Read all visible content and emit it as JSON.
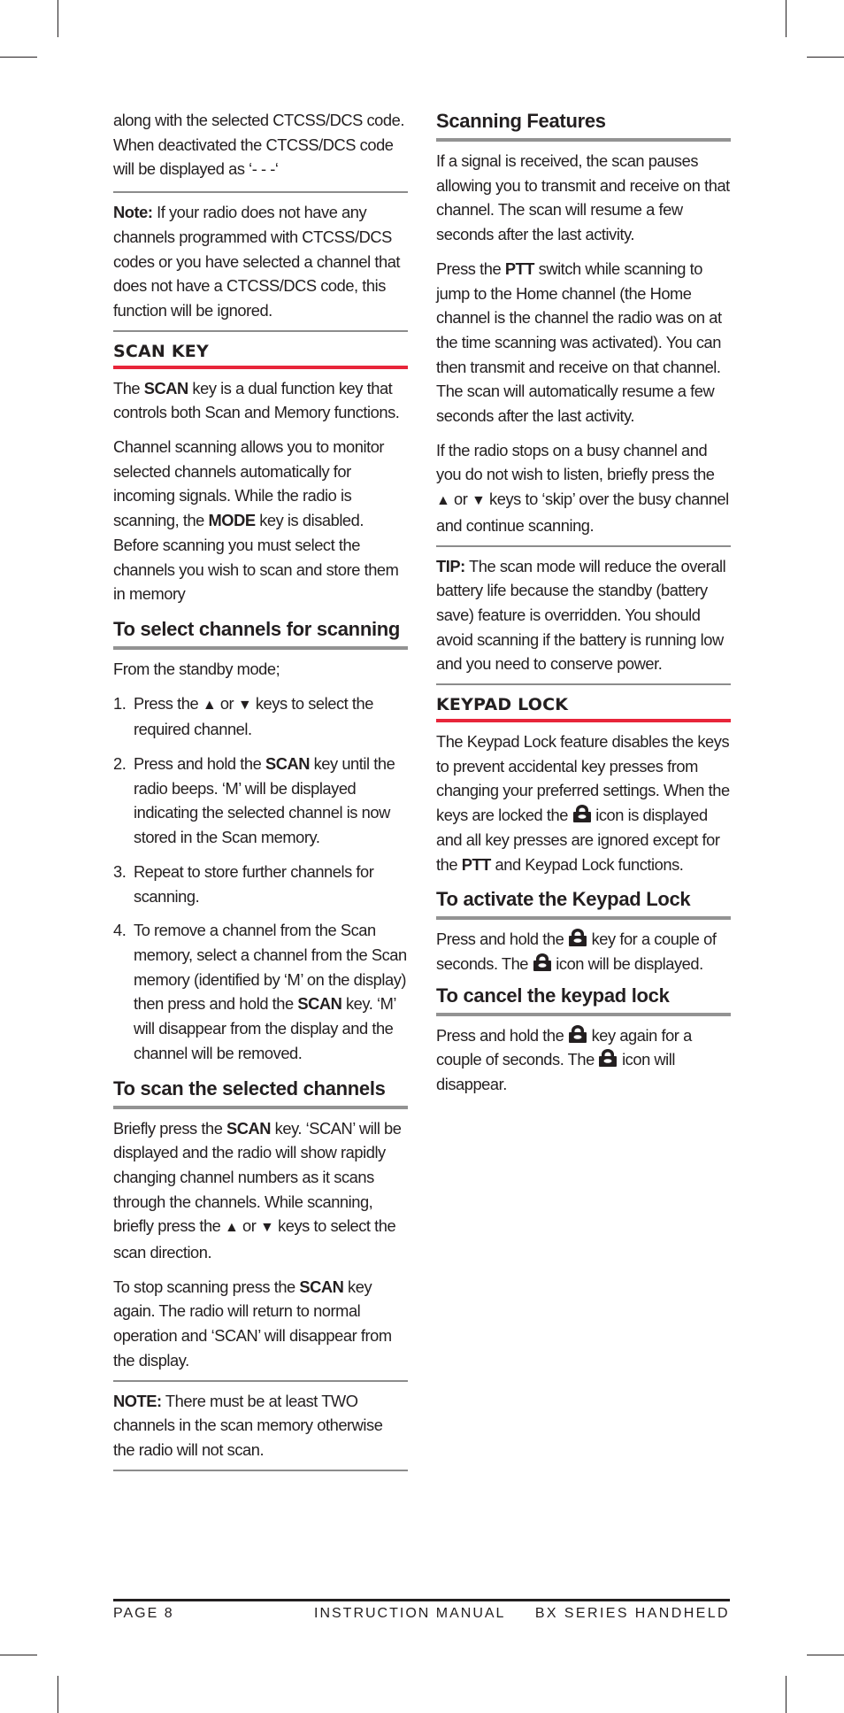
{
  "left_column": {
    "intro_text": "along with the selected CTCSS/DCS code. When deactivated the CTCSS/DCS code will be displayed as ‘- - -‘",
    "note1": {
      "label": "Note:",
      "text": " If your radio does not have any channels programmed with CTCSS/DCS codes or you have selected a channel that does not have a CTCSS/DCS code, this function will be ignored."
    },
    "scan_key": {
      "heading": "SCAN KEY",
      "p1": {
        "a": "The ",
        "b": "SCAN",
        "c": " key is a dual function key that controls both Scan and Memory functions."
      },
      "p2": {
        "a": "Channel scanning allows you to monitor selected channels automatically for incoming signals. While the radio is scanning, the ",
        "b": "MODE",
        "c": " key is disabled. Before scanning you must select the channels you wish to scan and store them in memory"
      }
    },
    "select_channels": {
      "heading": "To select channels for scanning",
      "intro": "From the standby mode;",
      "steps": [
        {
          "num": "1.",
          "a": "Press the ",
          "up": "▲",
          "or": " or ",
          "down": "▼",
          "b": " keys to select the required channel."
        },
        {
          "num": "2.",
          "a": "Press and hold the ",
          "bold": "SCAN",
          "b": " key until the radio beeps. ‘M’ will be displayed indicating the selected channel is now stored in the Scan memory."
        },
        {
          "num": "3.",
          "a": "Repeat to store further channels for scanning."
        },
        {
          "num": "4.",
          "a": "To remove a channel from the Scan memory, select a channel from the Scan memory (identified by ‘M’ on the display) then press and hold the ",
          "bold": "SCAN",
          "b": " key. ‘M’ will disappear from the display and the channel will be removed."
        }
      ]
    },
    "scan_selected": {
      "heading": "To scan the selected channels",
      "p1": {
        "a": "Briefly press the ",
        "b": "SCAN",
        "c": " key. ‘SCAN’ will be displayed and the radio will show rapidly changing channel numbers as it scans through the channels. While scanning, briefly press the ",
        "up": "▲",
        "or": " or ",
        "down": "▼",
        "d": " keys to select the scan direction."
      },
      "p2": {
        "a": "To stop scanning press the ",
        "b": "SCAN",
        "c": " key again. The radio will return to normal operation and ‘SCAN’ will disappear from the display."
      },
      "note": {
        "label": "NOTE:",
        "text": " There must be at least TWO channels in the scan memory otherwise the radio will not scan."
      }
    }
  },
  "right_column": {
    "scanning_features": {
      "heading": "Scanning Features",
      "p1": "If a signal is received, the scan pauses allowing you to transmit and receive on that channel. The scan will resume a few seconds after the last activity.",
      "p2": {
        "a": "Press the ",
        "b": "PTT",
        "c": " switch while scanning to jump to the Home channel (the Home channel is the channel the radio was on at the time scanning was activated). You can then transmit and receive on that channel. The scan will automatically resume a few seconds after the last activity."
      },
      "p3": {
        "a": "If the radio stops on a busy channel and you do not wish to listen, briefly press the ",
        "up": "▲",
        "or": " or ",
        "down": "▼",
        "b": " keys to ‘skip’ over the busy channel and continue scanning."
      },
      "tip": {
        "label": "TIP:",
        "text": " The scan mode will reduce the overall battery life because the standby (battery save) feature is overridden. You should avoid scanning if the battery is running low and you need to conserve power."
      }
    },
    "keypad_lock": {
      "heading": "KEYPAD LOCK",
      "p1": {
        "a": "The Keypad Lock feature disables the keys to prevent accidental key presses from changing your preferred settings. When the keys are locked the ",
        "b": " icon is displayed and all key presses are ignored except for the ",
        "bold": "PTT",
        "c": " and Keypad Lock functions."
      }
    },
    "activate_lock": {
      "heading": "To activate the Keypad Lock",
      "p1": {
        "a": "Press and hold the ",
        "b": " key for a couple of seconds. The ",
        "c": " icon will be displayed."
      }
    },
    "cancel_lock": {
      "heading": "To cancel the keypad lock",
      "p1": {
        "a": "Press and hold the ",
        "b": " key again for a couple of seconds. The ",
        "c": " icon will disappear."
      }
    }
  },
  "footer": {
    "page": "PAGE 8",
    "title": "INSTRUCTION MANUAL",
    "product": "BX SERIES HANDHELD"
  },
  "colors": {
    "accent_red": "#e8253a",
    "rule_grey": "#8c8c8c",
    "text": "#231f20"
  },
  "icons": {
    "lock": "padlock-icon",
    "up": "up-triangle-icon",
    "down": "down-triangle-icon"
  }
}
